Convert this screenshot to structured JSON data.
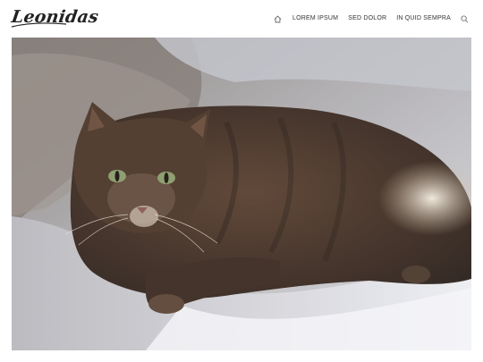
{
  "site": {
    "logo_text": "Leonidas"
  },
  "nav": {
    "home_icon": "home-icon",
    "items": [
      {
        "label": "LOREM IPSUM"
      },
      {
        "label": "SED DOLOR"
      },
      {
        "label": "IN QUID SEMPRA"
      }
    ],
    "search_icon": "search-icon"
  },
  "hero": {
    "image": "photo of a tabby cat lying on a bed"
  },
  "colors": {
    "text": "#333333",
    "background": "#ffffff"
  }
}
